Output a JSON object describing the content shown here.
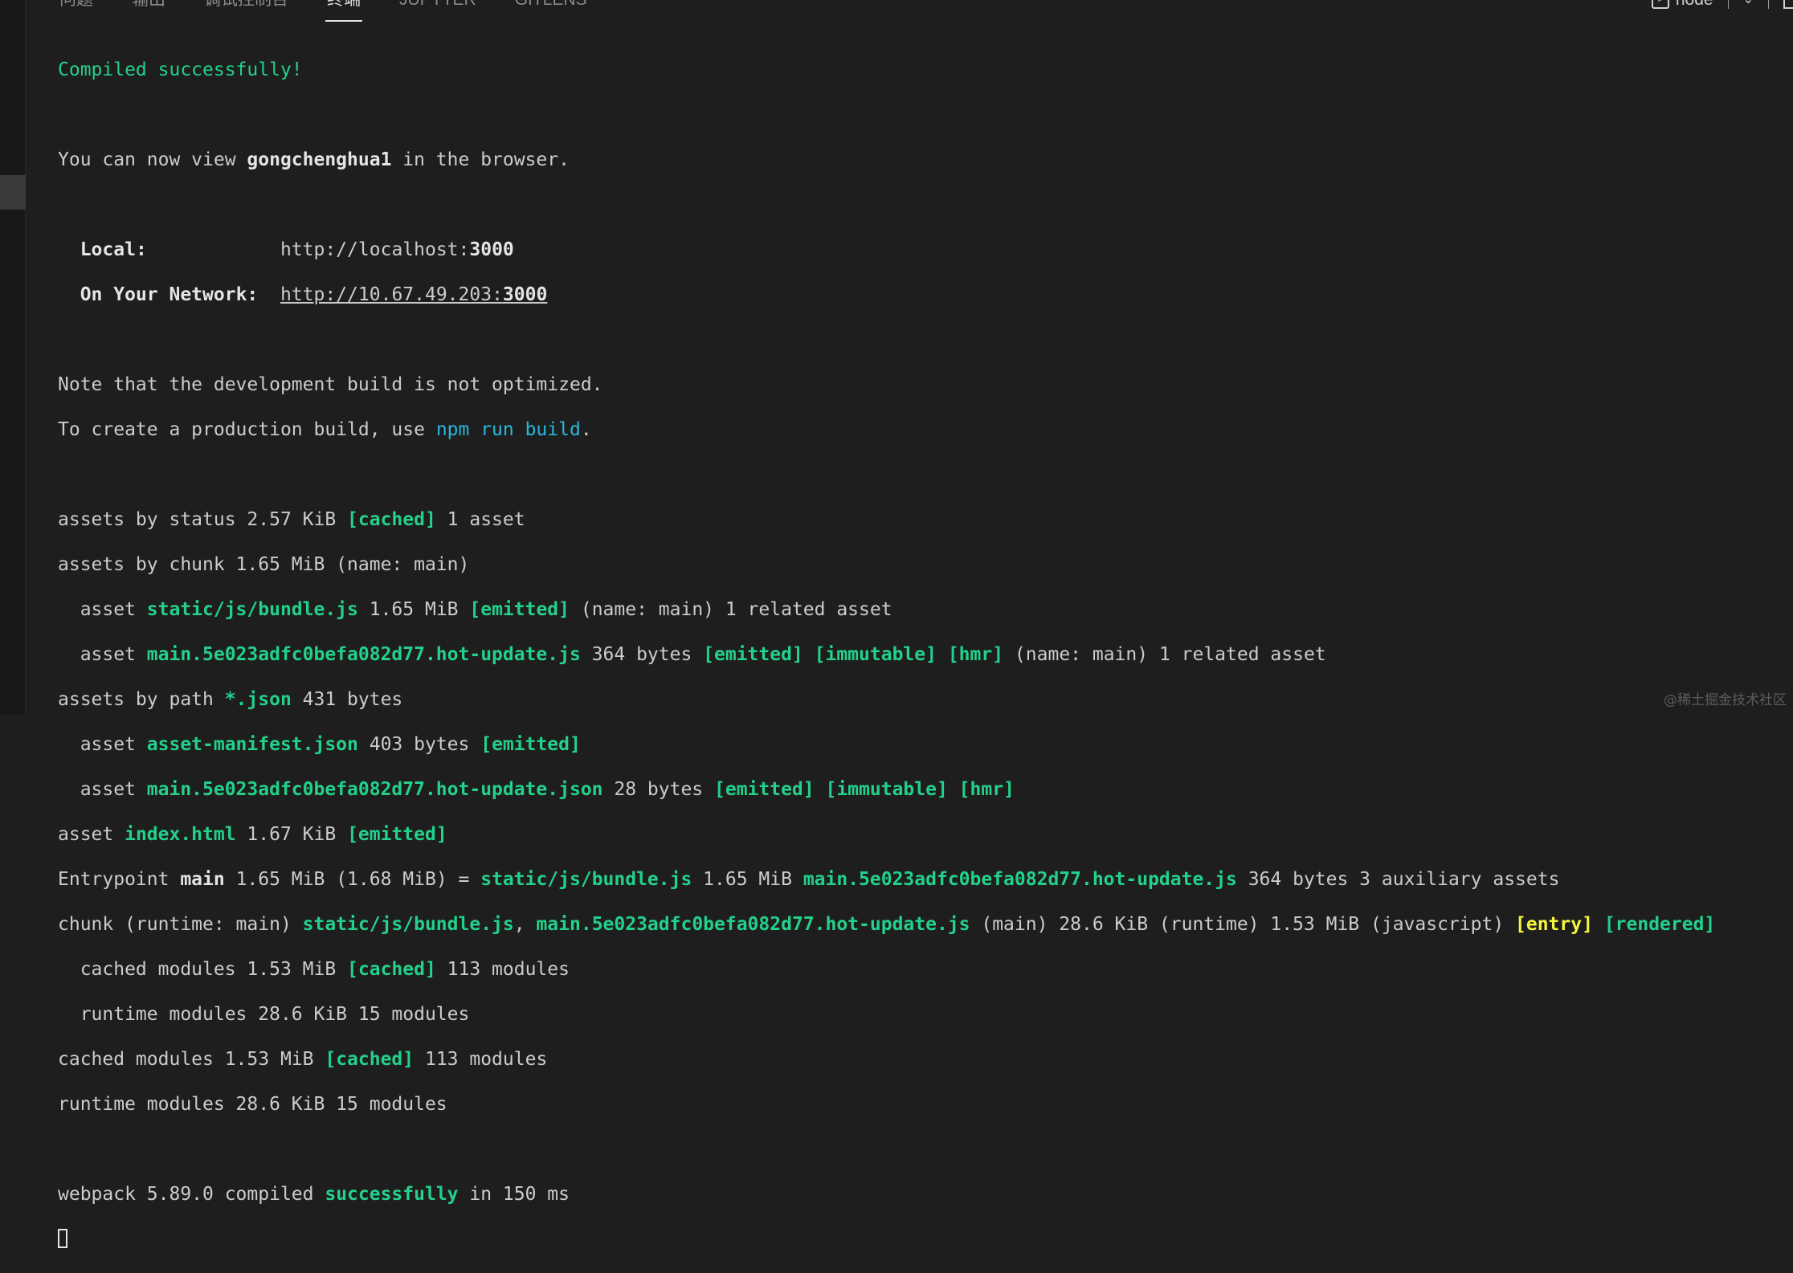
{
  "panel": {
    "tabs": [
      {
        "label": "问题",
        "active": false
      },
      {
        "label": "输出",
        "active": false
      },
      {
        "label": "调试控制台",
        "active": false
      },
      {
        "label": "终端",
        "active": true
      },
      {
        "label": "JUPYTER",
        "active": false
      },
      {
        "label": "GITLENS",
        "active": false
      }
    ],
    "shell_label": "node",
    "icons": [
      "terminal-icon",
      "chevron-down-icon",
      "maximize-icon"
    ]
  },
  "terminal": {
    "compiled": "Compiled successfully!",
    "view": {
      "prefix": "You can now view ",
      "app": "gongchenghua1",
      "suffix": " in the browser."
    },
    "local": {
      "label": "Local:",
      "pad": "            ",
      "url_prefix": "http://localhost:",
      "port": "3000"
    },
    "network": {
      "label": "On Your Network:",
      "pad": "  ",
      "url_prefix": "http://10.67.49.203:",
      "port": "3000"
    },
    "note1": "Note that the development build is not optimized.",
    "note2": {
      "prefix": "To create a production build, use ",
      "cmd": "npm run build",
      "suffix": "."
    },
    "a1": {
      "t1": "assets by status 2.57 KiB ",
      "tag": "[cached]",
      "t2": " 1 asset"
    },
    "a2": "assets by chunk 1.65 MiB (name: main)",
    "a3": {
      "indent": "  asset ",
      "file": "static/js/bundle.js",
      "t1": " 1.65 MiB ",
      "tag": "[emitted]",
      "t2": " (name: main) 1 related asset"
    },
    "a4": {
      "indent": "  asset ",
      "file": "main.5e023adfc0befa082d77.hot-update.js",
      "t1": " 364 bytes ",
      "tag1": "[emitted]",
      "tag2": "[immutable]",
      "tag3": "[hmr]",
      "t2": " (name: main) 1 related asset"
    },
    "a5": {
      "t1": "assets by path ",
      "glob": "*.json",
      "t2": " 431 bytes"
    },
    "a6": {
      "indent": "  asset ",
      "file": "asset-manifest.json",
      "t1": " 403 bytes ",
      "tag": "[emitted]"
    },
    "a7": {
      "indent": "  asset ",
      "file": "main.5e023adfc0befa082d77.hot-update.json",
      "t1": " 28 bytes ",
      "tag1": "[emitted]",
      "tag2": "[immutable]",
      "tag3": "[hmr]"
    },
    "a8": {
      "t1": "asset ",
      "file": "index.html",
      "t2": " 1.67 KiB ",
      "tag": "[emitted]"
    },
    "e1": {
      "t1": "Entrypoint ",
      "name": "main",
      "t2": " 1.65 MiB (1.68 MiB) = ",
      "f1": "static/js/bundle.js",
      "t3": " 1.65 MiB ",
      "f2": "main.5e023adfc0befa082d77.hot-update.js",
      "t4": " 364 bytes 3 auxiliary assets"
    },
    "c1": {
      "t1": "chunk (runtime: main) ",
      "f1": "static/js/bundle.js",
      "t2": ", ",
      "f2": "main.5e023adfc0befa082d77.hot-update.js",
      "t3": " (main) 28.6 KiB (runtime) 1.53 MiB (javascript) ",
      "tag1": "[entry]",
      "tag2": "[rendered]"
    },
    "m1": {
      "t1": "  cached modules 1.53 MiB ",
      "tag": "[cached]",
      "t2": " 113 modules"
    },
    "m2": "  runtime modules 28.6 KiB 15 modules",
    "m3": {
      "t1": "cached modules 1.53 MiB ",
      "tag": "[cached]",
      "t2": " 113 modules"
    },
    "m4": "runtime modules 28.6 KiB 15 modules",
    "done": {
      "t1": "webpack 5.89.0 compiled ",
      "status": "successfully",
      "t2": " in 150 ms"
    }
  },
  "watermark": "@稀土掘金技术社区"
}
